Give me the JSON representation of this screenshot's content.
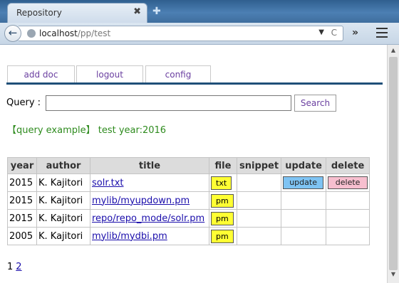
{
  "browser": {
    "tab_title": "Repository",
    "tab_close": "✖",
    "new_tab": "✚",
    "back": "←",
    "url_host": "localhost",
    "url_path": "/pp/test",
    "url_dropdown": "▼",
    "reload": "C",
    "overflow": "»",
    "scroll_up": "▲",
    "scroll_down": "▼"
  },
  "nav": {
    "add_doc": "add doc",
    "logout": "logout",
    "config": "config"
  },
  "search": {
    "label": "Query :",
    "value": "",
    "button": "Search",
    "example": "【query example】 test year:2016"
  },
  "table": {
    "headers": [
      "year",
      "author",
      "title",
      "file",
      "snippet",
      "update",
      "delete"
    ],
    "rows": [
      {
        "year": "2015",
        "author": "K. Kajitori",
        "title": "solr.txt",
        "file": "txt",
        "update": "update",
        "delete": "delete"
      },
      {
        "year": "2015",
        "author": "K. Kajitori",
        "title": "mylib/myupdown.pm",
        "file": "pm"
      },
      {
        "year": "2015",
        "author": "K. Kajitori",
        "title": "repo/repo_mode/solr.pm",
        "file": "pm"
      },
      {
        "year": "2005",
        "author": "K. Kajitori",
        "title": "mylib/mydbi.pm",
        "file": "pm"
      }
    ]
  },
  "pagination": {
    "current": "1",
    "next": "2"
  },
  "colors": {
    "tab_line": "#1f4f78",
    "link": "#1a0dab",
    "query_example": "#2e8b1e",
    "file_button": "#ffff33",
    "update_button": "#7ec3f3",
    "delete_button": "#f7bfcf"
  }
}
